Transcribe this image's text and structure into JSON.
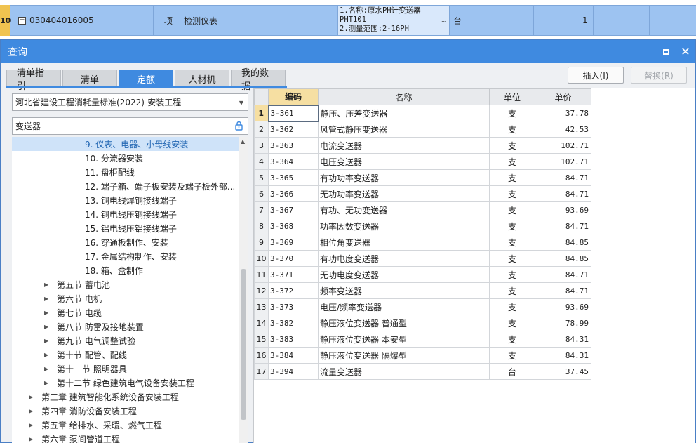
{
  "sheet": {
    "row_number": "10",
    "code": "030404016005",
    "type": "项",
    "name": "检测仪表",
    "features": [
      "1.名称:原水PH计变送器",
      "PHT101",
      "2.测量范围:2-16PH"
    ],
    "features_more": "…",
    "unit": "台",
    "quantity": "1"
  },
  "dialog": {
    "title": "查询",
    "tabs": [
      "清单指引",
      "清单",
      "定额",
      "人材机",
      "我的数据"
    ],
    "active_tab": 2,
    "insert_label": "插入(I)",
    "replace_label": "替换(R)"
  },
  "library": {
    "selected": "河北省建设工程消耗量标准(2022)-安装工程"
  },
  "search": {
    "value": "变送器"
  },
  "tree": [
    {
      "label": "9. 仪表、电器、小母线安装",
      "level": 3,
      "selected": true
    },
    {
      "label": "10. 分流器安装",
      "level": 3
    },
    {
      "label": "11. 盘柜配线",
      "level": 3
    },
    {
      "label": "12. 端子箱、端子板安装及端子板外部...",
      "level": 3
    },
    {
      "label": "13. 铜电线焊铜接线端子",
      "level": 3
    },
    {
      "label": "14. 铜电线压铜接线端子",
      "level": 3
    },
    {
      "label": "15. 铝电线压铝接线端子",
      "level": 3
    },
    {
      "label": "16. 穿通板制作、安装",
      "level": 3
    },
    {
      "label": "17. 金属结构制作、安装",
      "level": 3
    },
    {
      "label": "18. 箱、盒制作",
      "level": 3
    },
    {
      "label": "第五节 蓄电池",
      "level": 2,
      "collapsed": true
    },
    {
      "label": "第六节 电机",
      "level": 2,
      "collapsed": true
    },
    {
      "label": "第七节 电缆",
      "level": 2,
      "collapsed": true
    },
    {
      "label": "第八节 防雷及接地装置",
      "level": 2,
      "collapsed": true
    },
    {
      "label": "第九节 电气调整试验",
      "level": 2,
      "collapsed": true
    },
    {
      "label": "第十节 配管、配线",
      "level": 2,
      "collapsed": true
    },
    {
      "label": "第十一节 照明器具",
      "level": 2,
      "collapsed": true
    },
    {
      "label": "第十二节 绿色建筑电气设备安装工程",
      "level": 2,
      "collapsed": true
    },
    {
      "label": "第三章 建筑智能化系统设备安装工程",
      "level": 1,
      "collapsed": true
    },
    {
      "label": "第四章 消防设备安装工程",
      "level": 1,
      "collapsed": true
    },
    {
      "label": "第五章 给排水、采暖、燃气工程",
      "level": 1,
      "collapsed": true
    },
    {
      "label": "第六章 泵间管道工程",
      "level": 1,
      "collapsed": true
    }
  ],
  "grid": {
    "headers": [
      "编码",
      "名称",
      "单位",
      "单价"
    ],
    "rows": [
      {
        "n": "1",
        "code": "3-361",
        "name": "静压、压差变送器",
        "unit": "支",
        "price": "37.78"
      },
      {
        "n": "2",
        "code": "3-362",
        "name": "风管式静压变送器",
        "unit": "支",
        "price": "42.53"
      },
      {
        "n": "3",
        "code": "3-363",
        "name": "电流变送器",
        "unit": "支",
        "price": "102.71"
      },
      {
        "n": "4",
        "code": "3-364",
        "name": "电压变送器",
        "unit": "支",
        "price": "102.71"
      },
      {
        "n": "5",
        "code": "3-365",
        "name": "有功功率变送器",
        "unit": "支",
        "price": "84.71"
      },
      {
        "n": "6",
        "code": "3-366",
        "name": "无功功率变送器",
        "unit": "支",
        "price": "84.71"
      },
      {
        "n": "7",
        "code": "3-367",
        "name": "有功、无功变送器",
        "unit": "支",
        "price": "93.69"
      },
      {
        "n": "8",
        "code": "3-368",
        "name": "功率因数变送器",
        "unit": "支",
        "price": "84.71"
      },
      {
        "n": "9",
        "code": "3-369",
        "name": "相位角变送器",
        "unit": "支",
        "price": "84.85"
      },
      {
        "n": "10",
        "code": "3-370",
        "name": "有功电度变送器",
        "unit": "支",
        "price": "84.85"
      },
      {
        "n": "11",
        "code": "3-371",
        "name": "无功电度变送器",
        "unit": "支",
        "price": "84.71"
      },
      {
        "n": "12",
        "code": "3-372",
        "name": "频率变送器",
        "unit": "支",
        "price": "84.71"
      },
      {
        "n": "13",
        "code": "3-373",
        "name": "电压/频率变送器",
        "unit": "支",
        "price": "93.69"
      },
      {
        "n": "14",
        "code": "3-382",
        "name": "静压液位变送器 普通型",
        "unit": "支",
        "price": "78.99"
      },
      {
        "n": "15",
        "code": "3-383",
        "name": "静压液位变送器 本安型",
        "unit": "支",
        "price": "84.31"
      },
      {
        "n": "16",
        "code": "3-384",
        "name": "静压液位变送器 隔爆型",
        "unit": "支",
        "price": "84.31"
      },
      {
        "n": "17",
        "code": "3-394",
        "name": "流量变送器",
        "unit": "台",
        "price": "37.45"
      }
    ]
  },
  "icons": {
    "collapse": "minus-box-icon",
    "expand": "caret-right-icon",
    "dropdown": "chevron-down-icon",
    "search_clear": "eraser-icon",
    "restore": "restore-window-icon",
    "close": "close-icon"
  },
  "colors": {
    "accent": "#3f8ae0",
    "selected_row": "#9dc3f1",
    "header_highlight": "#f6dfa2"
  }
}
